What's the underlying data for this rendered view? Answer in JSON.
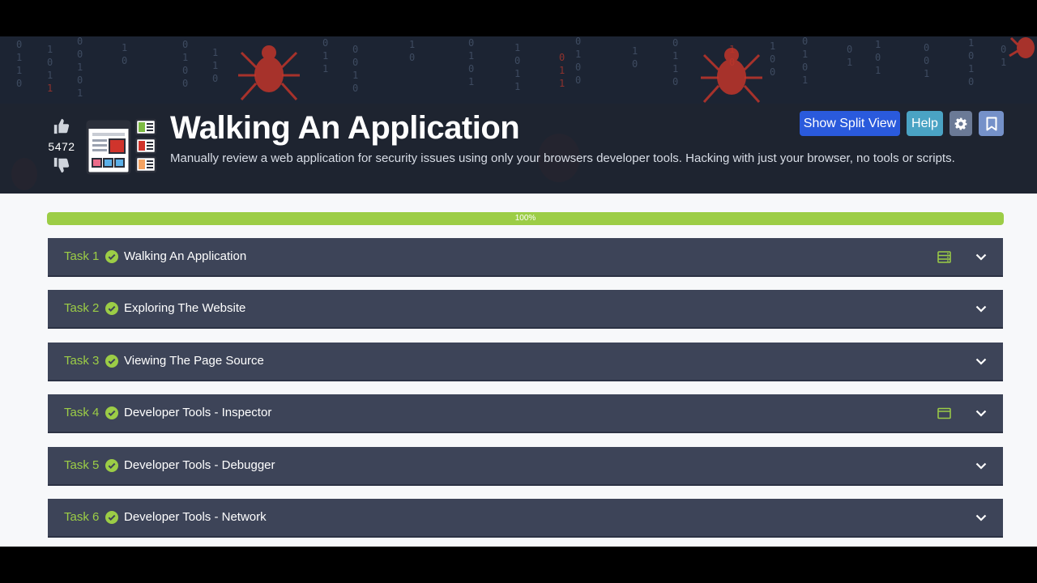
{
  "room": {
    "title": "Walking An Application",
    "description": "Manually review a web application for security issues using only your browsers developer tools. Hacking with just your browser, no tools or scripts.",
    "votes": "5472"
  },
  "header_buttons": {
    "split_view": "Show Split View",
    "help": "Help",
    "settings_icon": "gear-icon",
    "bookmark_icon": "bookmark-icon"
  },
  "progress": {
    "value": 100,
    "label": "100%"
  },
  "tasks": [
    {
      "number": "Task 1",
      "title": "Walking An Application",
      "extra_icon": "server-icon"
    },
    {
      "number": "Task 2",
      "title": "Exploring The Website",
      "extra_icon": ""
    },
    {
      "number": "Task 3",
      "title": "Viewing The Page Source",
      "extra_icon": ""
    },
    {
      "number": "Task 4",
      "title": "Developer Tools - Inspector",
      "extra_icon": "browser-window-icon"
    },
    {
      "number": "Task 5",
      "title": "Developer Tools - Debugger",
      "extra_icon": ""
    },
    {
      "number": "Task 6",
      "title": "Developer Tools - Network",
      "extra_icon": ""
    }
  ],
  "colors": {
    "accent_green": "#9ccd46",
    "task_bg": "#3d4458",
    "split_view_blue": "#2a5adc",
    "help_teal": "#4aa3c4"
  }
}
